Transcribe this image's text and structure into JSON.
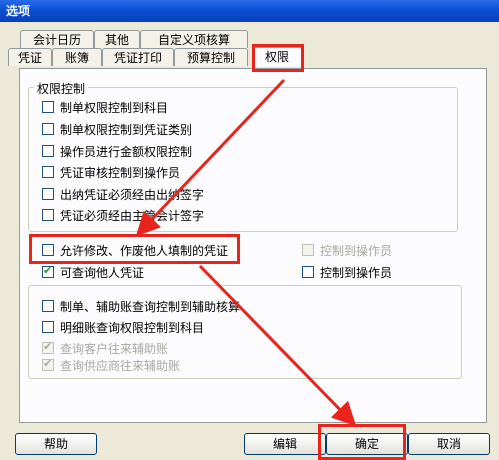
{
  "window": {
    "title": "选项"
  },
  "tabs_row1": [
    {
      "label": "会计日历"
    },
    {
      "label": "其他"
    },
    {
      "label": "自定义项核算"
    }
  ],
  "tabs_row2": [
    {
      "label": "凭证"
    },
    {
      "label": "账簿"
    },
    {
      "label": "凭证打印"
    },
    {
      "label": "预算控制"
    },
    {
      "label": "权限",
      "active": true
    }
  ],
  "permission_group": {
    "legend": "权限控制",
    "items": [
      {
        "label": "制单权限控制到科目",
        "checked": false
      },
      {
        "label": "制单权限控制到凭证类别",
        "checked": false
      },
      {
        "label": "操作员进行金额权限控制",
        "checked": false
      },
      {
        "label": "凭证审核控制到操作员",
        "checked": false
      },
      {
        "label": "出纳凭证必须经由出纳签字",
        "checked": false
      },
      {
        "label": "凭证必须经由主管会计签字",
        "checked": false
      }
    ]
  },
  "middle_options": {
    "allow_modify": {
      "label": "允许修改、作废他人填制的凭证",
      "checked": false
    },
    "control_to_operator_disabled": {
      "label": "控制到操作员",
      "checked": false,
      "disabled": true
    },
    "view_others": {
      "label": "可查询他人凭证",
      "checked": true
    },
    "control_to_operator": {
      "label": "控制到操作员",
      "checked": false
    }
  },
  "query_group": {
    "items": [
      {
        "label": "制单、辅助账查询控制到辅助核算",
        "checked": false,
        "disabled": false
      },
      {
        "label": "明细账查询权限控制到科目",
        "checked": false,
        "disabled": false
      },
      {
        "label": "查询客户往来辅助账",
        "checked": true,
        "disabled": true
      },
      {
        "label": "查询供应商往来辅助账",
        "checked": true,
        "disabled": true
      }
    ]
  },
  "buttons": {
    "help": "帮助",
    "edit": "编辑",
    "ok": "确定",
    "cancel": "取消"
  },
  "colors": {
    "annotation": "#e8241c",
    "title_bar": "#0a4fd4"
  }
}
